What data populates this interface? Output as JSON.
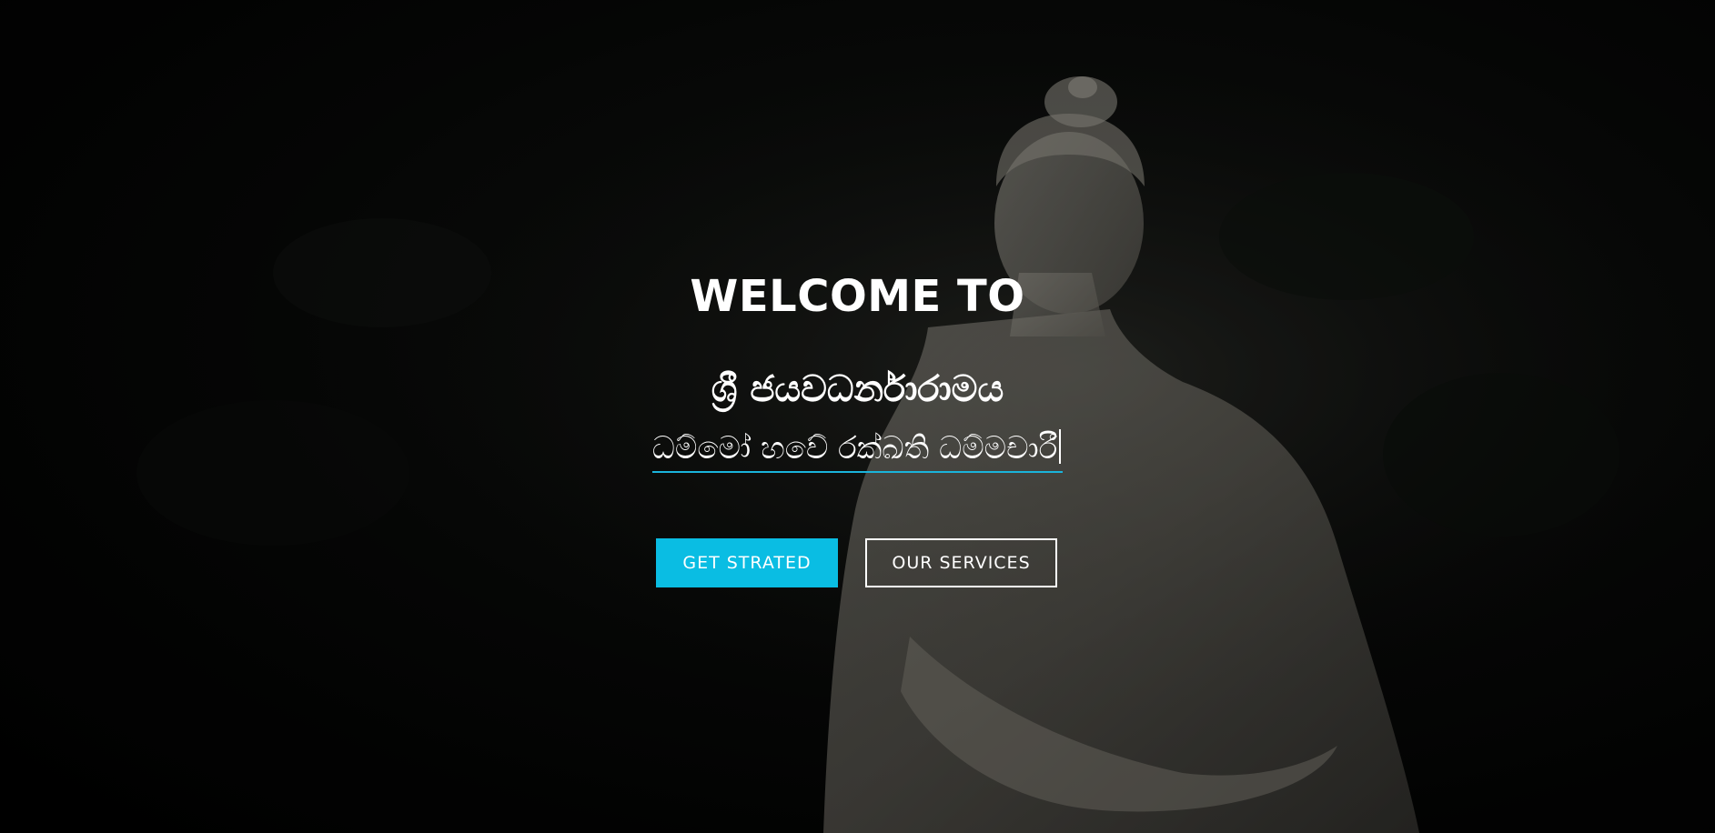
{
  "hero": {
    "welcome": "WELCOME TO",
    "temple_name": "ශ්‍රී ජයවධර්නාරාමය",
    "tagline": "ධම්මෝ හවේ රක්ඛති ධම්මචාරී"
  },
  "buttons": {
    "primary_label": "GET STRATED",
    "secondary_label": "OUR SERVICES"
  },
  "colors": {
    "accent": "#0abde3",
    "text": "#ffffff",
    "background": "#000000"
  }
}
